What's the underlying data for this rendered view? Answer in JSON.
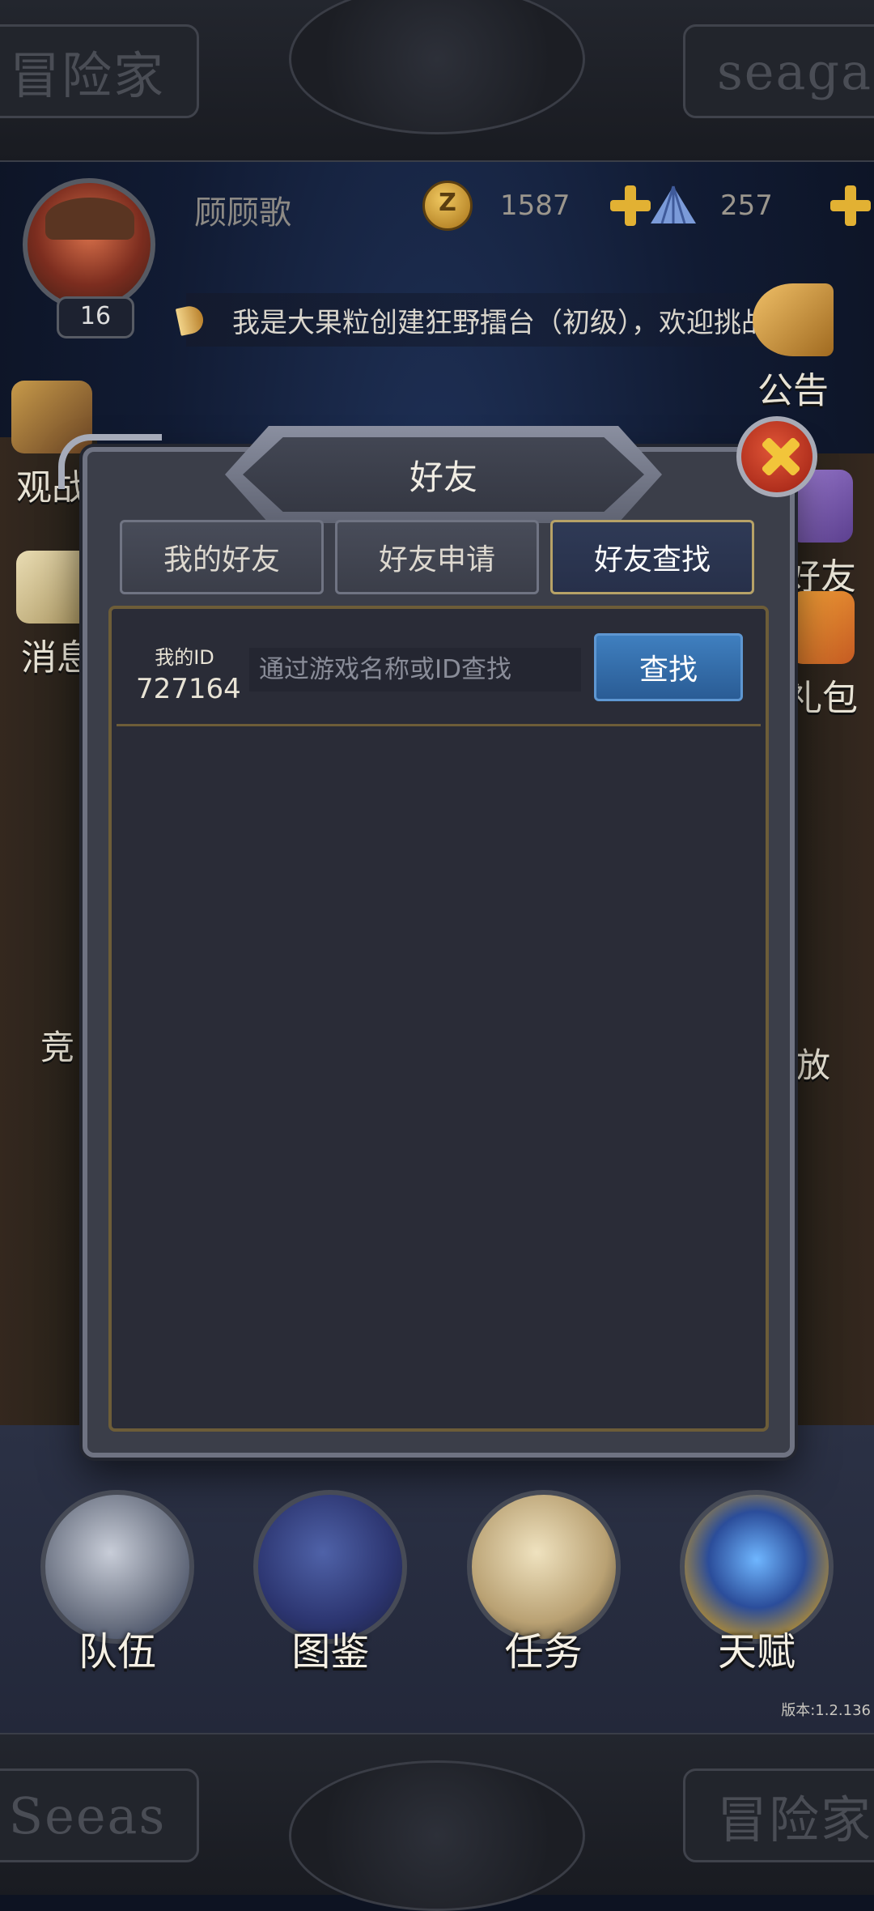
{
  "frame": {
    "top_left_plate": "冒险家",
    "top_right_plate": "seaga",
    "bottom_left_plate": "Seeas",
    "bottom_right_plate": "冒险家"
  },
  "player": {
    "name": "顾顾歌",
    "level": "16",
    "coins": "1587",
    "shells": "257"
  },
  "announcement": "我是大果粒创建狂野擂台（初级），欢迎挑战",
  "side_buttons": {
    "left": [
      "观战",
      "消息",
      "竞"
    ],
    "right": [
      "公告",
      "好友",
      "礼包",
      "放"
    ]
  },
  "dialog": {
    "title": "好友",
    "tabs": [
      {
        "label": "我的好友",
        "active": false
      },
      {
        "label": "好友申请",
        "active": false
      },
      {
        "label": "好友查找",
        "active": true
      }
    ],
    "my_id_label": "我的ID",
    "my_id_value": "727164",
    "search_placeholder": "通过游戏名称或ID查找",
    "search_button": "查找"
  },
  "bottom_nav": [
    {
      "label": "队伍",
      "icon": "knight-helmet-icon"
    },
    {
      "label": "图鉴",
      "icon": "book-icon"
    },
    {
      "label": "任务",
      "icon": "scroll-icon"
    },
    {
      "label": "天赋",
      "icon": "winged-crest-icon"
    }
  ],
  "version": "版本:1.2.136",
  "colors": {
    "accent_gold": "#b7a267",
    "button_blue": "#3f7fbf",
    "close_red": "#c83a24"
  }
}
